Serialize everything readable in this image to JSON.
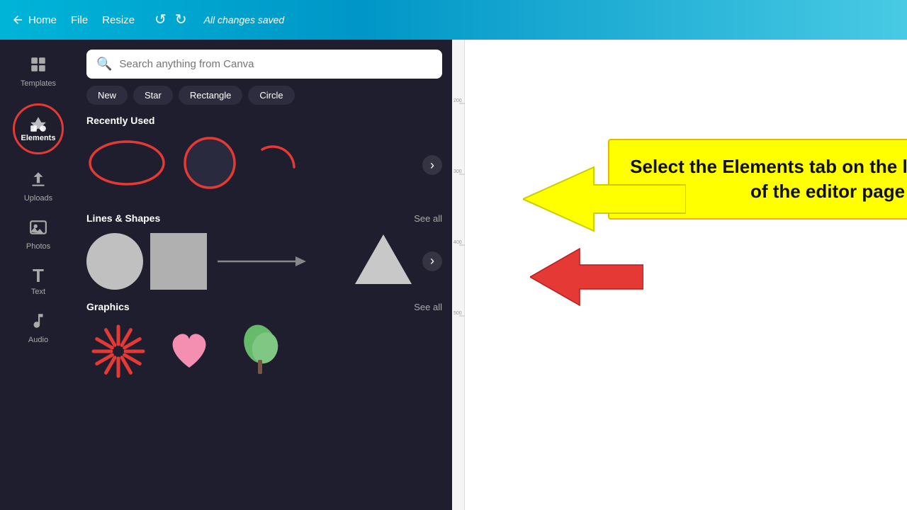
{
  "topbar": {
    "back_icon": "←",
    "home_label": "Home",
    "file_label": "File",
    "resize_label": "Resize",
    "undo_icon": "↺",
    "redo_icon": "↻",
    "saved_text": "All changes saved"
  },
  "sidebar": {
    "items": [
      {
        "id": "templates",
        "label": "Templates",
        "icon": "⊞"
      },
      {
        "id": "elements",
        "label": "Elements",
        "icon": "◈"
      },
      {
        "id": "uploads",
        "label": "Uploads",
        "icon": "⬆"
      },
      {
        "id": "photos",
        "label": "Photos",
        "icon": "🖼"
      },
      {
        "id": "text",
        "label": "Text",
        "icon": "T"
      },
      {
        "id": "audio",
        "label": "Audio",
        "icon": "♪"
      }
    ]
  },
  "elements_panel": {
    "search_placeholder": "Search anything from Canva",
    "filter_chips": [
      "New",
      "Star",
      "Rectangle",
      "Circle"
    ],
    "recently_used_label": "Recently Used",
    "lines_shapes_label": "Lines & Shapes",
    "lines_shapes_see_all": "See all",
    "graphics_label": "Graphics",
    "graphics_see_all": "See all"
  },
  "instruction": {
    "text": "Select the Elements tab on the left side panel of the editor page"
  }
}
